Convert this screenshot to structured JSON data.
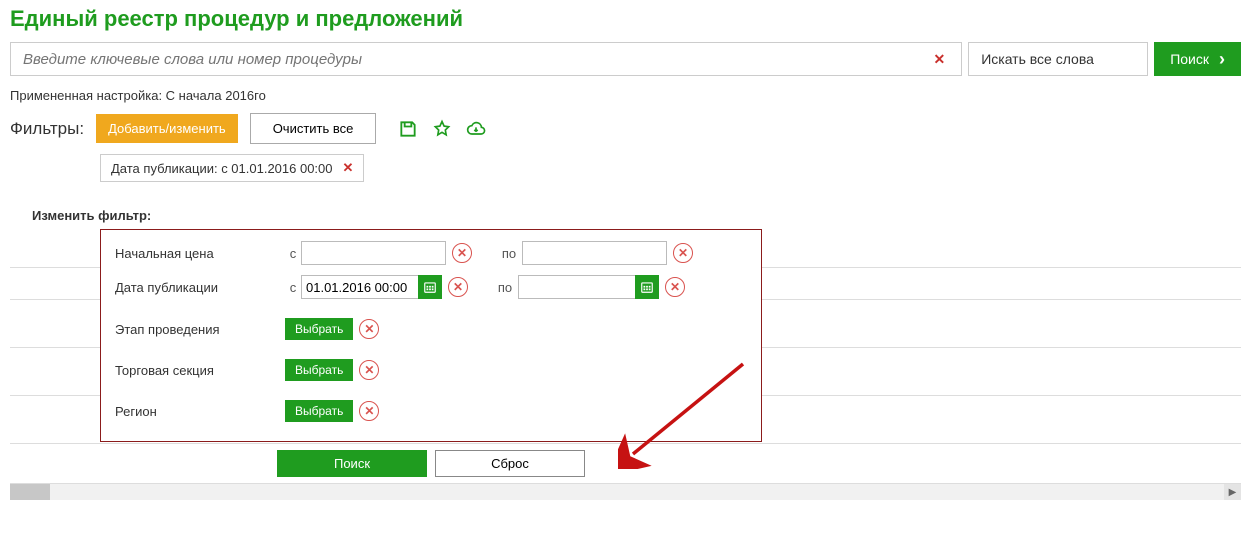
{
  "title": "Единый реестр процедур и предложений",
  "search": {
    "placeholder": "Введите ключевые слова или номер процедуры",
    "value": "",
    "mode_label": "Искать все слова",
    "button": "Поиск"
  },
  "applied_setting": "Примененная настройка: С начала 2016го",
  "filters": {
    "label": "Фильтры:",
    "add_edit": "Добавить/изменить",
    "clear_all": "Очистить все",
    "chip": "Дата публикации: с 01.01.2016 00:00"
  },
  "change_filter_label": "Изменить фильтр:",
  "panel": {
    "from": "с",
    "to": "по",
    "select": "Выбрать",
    "rows": {
      "start_price": "Начальная цена",
      "pub_date": "Дата публикации",
      "pub_date_from_value": "01.01.2016 00:00",
      "stage": "Этап проведения",
      "section": "Торговая секция",
      "region": "Регион"
    }
  },
  "bottom": {
    "search": "Поиск",
    "reset": "Сброс"
  }
}
